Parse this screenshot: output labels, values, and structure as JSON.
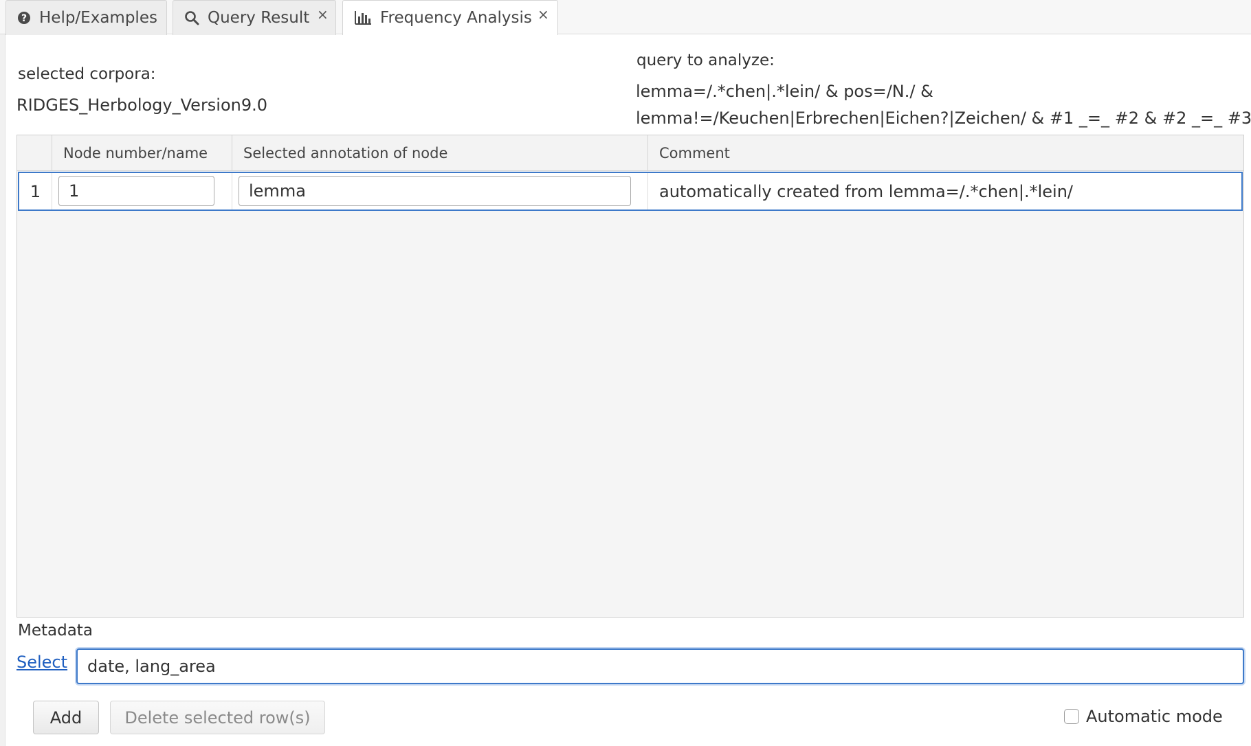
{
  "tabs": [
    {
      "label": "Help/Examples",
      "icon": "help-circle-icon",
      "closable": false
    },
    {
      "label": "Query Result",
      "icon": "search-icon",
      "closable": true
    },
    {
      "label": "Frequency Analysis",
      "icon": "bar-chart-icon",
      "closable": true,
      "active": true
    }
  ],
  "tab_close_glyph": "×",
  "info": {
    "corpora_label": "selected corpora:",
    "corpora_value": "RIDGES_Herbology_Version9.0",
    "query_label": "query to analyze:",
    "query_line1": "lemma=/.*chen|.*lein/ & pos=/N./ &",
    "query_line2": "lemma!=/Keuchen|Erbrechen|Eichen?|Zeichen/ & #1 _=_ #2 & #2 _=_ #3"
  },
  "grid": {
    "columns": [
      "Node number/name",
      "Selected annotation of node",
      "Comment"
    ],
    "rows": [
      {
        "index": "1",
        "node": "1",
        "annotation": "lemma",
        "comment": "automatically created from lemma=/.*chen|.*lein/"
      }
    ]
  },
  "metadata": {
    "label": "Metadata",
    "select_link": "Select",
    "value": "date, lang_area"
  },
  "buttons": {
    "add": "Add",
    "delete": "Delete selected row(s)"
  },
  "automatic_mode": {
    "label": "Automatic mode",
    "checked": false
  },
  "colors": {
    "accent": "#3d79c9",
    "link": "#1f5fc0"
  }
}
